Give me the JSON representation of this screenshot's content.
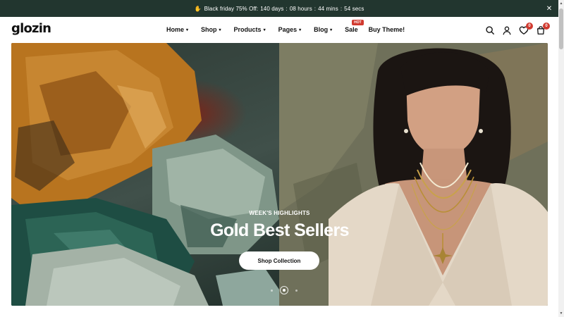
{
  "announcement": {
    "icon": "waving-hand-icon",
    "text": "Black friday 75% Off:",
    "countdown": {
      "days": "140 days",
      "hours": "08 hours",
      "mins": "44 mins",
      "secs": "54 secs",
      "separator": ":"
    },
    "close_icon": "close-icon"
  },
  "header": {
    "logo": "glozin",
    "nav": [
      {
        "label": "Home",
        "dropdown": true
      },
      {
        "label": "Shop",
        "dropdown": true
      },
      {
        "label": "Products",
        "dropdown": true
      },
      {
        "label": "Pages",
        "dropdown": true
      },
      {
        "label": "Blog",
        "dropdown": true
      },
      {
        "label": "Sale",
        "badge": "HOT"
      },
      {
        "label": "Buy Theme!"
      }
    ],
    "icons": {
      "search": "search-icon",
      "account": "user-icon",
      "wishlist": "heart-icon",
      "wishlist_count": "0",
      "cart": "bag-icon",
      "cart_count": "0"
    }
  },
  "hero": {
    "kicker": "WEEK'S HIGHLIGHTS",
    "headline": "Gold Best Sellers",
    "cta": "Shop Collection",
    "slides": 3,
    "active_slide": 2
  },
  "colors": {
    "announcement_bg": "#22362f",
    "badge_red": "#d13a2f",
    "text": "#111111",
    "white": "#ffffff"
  }
}
